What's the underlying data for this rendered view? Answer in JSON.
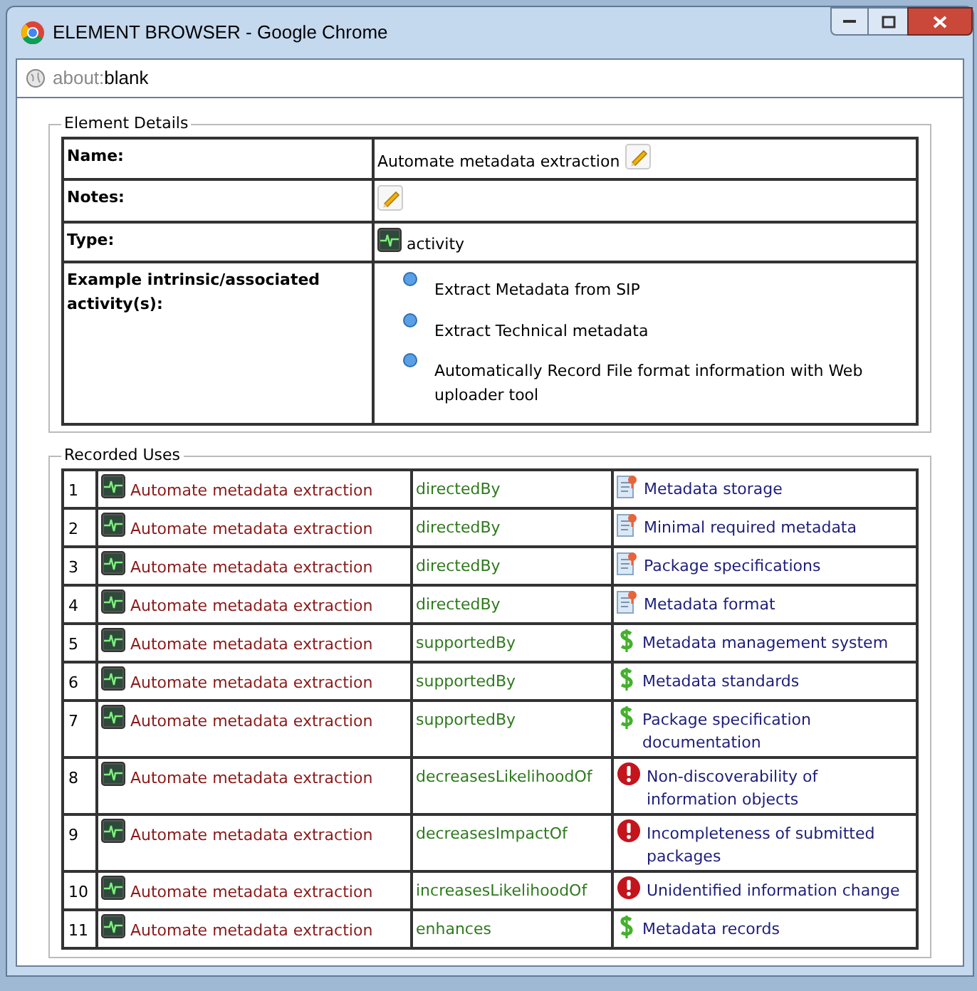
{
  "window": {
    "title": "ELEMENT BROWSER - Google Chrome"
  },
  "address_bar": {
    "prefix": "about:",
    "value": "blank"
  },
  "element_details": {
    "legend": "Element Details",
    "rows": [
      {
        "label": "Name:",
        "kind": "text_edit",
        "value": "Automate metadata extraction"
      },
      {
        "label": "Notes:",
        "kind": "edit"
      },
      {
        "label": "Type:",
        "kind": "type",
        "value": "activity"
      },
      {
        "label": "Example intrinsic/associated activity(s):",
        "kind": "list",
        "items": [
          "Extract Metadata from SIP",
          "Extract Technical metadata",
          "Automatically Record File format information with Web uploader tool"
        ]
      }
    ]
  },
  "recorded_uses": {
    "legend": "Recorded Uses",
    "rows": [
      {
        "number": "1",
        "subject": "Automate metadata extraction",
        "relation": "directedBy",
        "object": "Metadata storage",
        "kind": "document"
      },
      {
        "number": "2",
        "subject": "Automate metadata extraction",
        "relation": "directedBy",
        "object": "Minimal required metadata",
        "kind": "document"
      },
      {
        "number": "3",
        "subject": "Automate metadata extraction",
        "relation": "directedBy",
        "object": "Package specifications",
        "kind": "document"
      },
      {
        "number": "4",
        "subject": "Automate metadata extraction",
        "relation": "directedBy",
        "object": "Metadata format",
        "kind": "document"
      },
      {
        "number": "5",
        "subject": "Automate metadata extraction",
        "relation": "supportedBy",
        "object": "Metadata management system",
        "kind": "dollar"
      },
      {
        "number": "6",
        "subject": "Automate metadata extraction",
        "relation": "supportedBy",
        "object": "Metadata standards",
        "kind": "dollar"
      },
      {
        "number": "7",
        "subject": "Automate metadata extraction",
        "relation": "supportedBy",
        "object": "Package specification documentation",
        "kind": "dollar"
      },
      {
        "number": "8",
        "subject": "Automate metadata extraction",
        "relation": "decreasesLikelihoodOf",
        "object": "Non-discoverability of information objects",
        "kind": "risk"
      },
      {
        "number": "9",
        "subject": "Automate metadata extraction",
        "relation": "decreasesImpactOf",
        "object": "Incompleteness of submitted packages",
        "kind": "risk"
      },
      {
        "number": "10",
        "subject": "Automate metadata extraction",
        "relation": "increasesLikelihoodOf",
        "object": "Unidentified information change",
        "kind": "risk"
      },
      {
        "number": "11",
        "subject": "Automate metadata extraction",
        "relation": "enhances",
        "object": "Metadata records",
        "kind": "dollar"
      }
    ]
  }
}
